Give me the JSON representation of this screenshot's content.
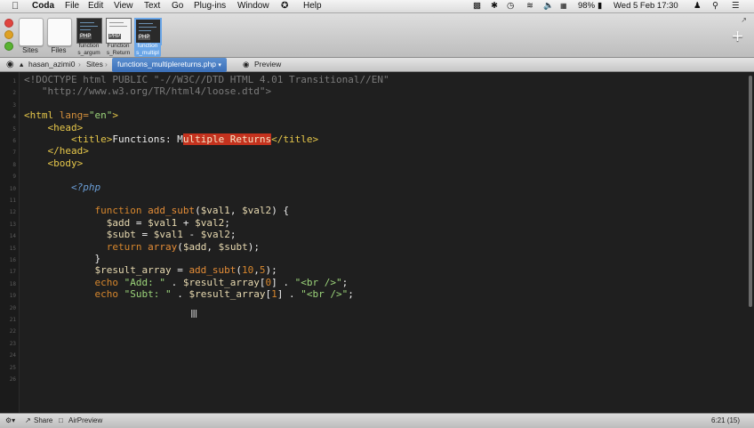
{
  "menubar": {
    "apple_icon": "apple-icon",
    "app": "Coda",
    "items": [
      "File",
      "Edit",
      "View",
      "Text",
      "Go",
      "Plug-ins",
      "Window",
      "Help"
    ],
    "battery": "98%",
    "datetime": "Wed 5 Feb  17:30",
    "flag": "UK"
  },
  "toolbar": {
    "sites_label": "Sites",
    "files_label": "Files",
    "tabs": [
      {
        "php": "PHP",
        "caption1": "function",
        "caption2": "s_argum"
      },
      {
        "php": "PHP",
        "caption1": "Function",
        "caption2": "s_Return"
      },
      {
        "php": "PHP",
        "caption1": "function",
        "caption2": "s_multipl"
      }
    ],
    "plus": "+"
  },
  "pathbar": {
    "user": "hasan_azimi0",
    "sites": "Sites",
    "file": "functions_multiplereturns.php",
    "preview": "Preview"
  },
  "editor": {
    "line_numbers": [
      "1",
      "2",
      "3",
      "4",
      "5",
      "6",
      "7",
      "8",
      "9",
      "10",
      "11",
      "12",
      "13",
      "14",
      "15",
      "16",
      "17",
      "18",
      "19",
      "20",
      "21",
      "22",
      "23",
      "24",
      "25",
      "26"
    ],
    "colors": {
      "comment": "#7b7b7b",
      "tag": "#e6c74a",
      "attr": "#d38f3c",
      "string": "#9cd47a",
      "keyword": "#d6862d",
      "function": "#e38c37",
      "variable": "#e7d9b0",
      "plain": "#eeeeee",
      "phpopen": "#6b9ed6",
      "highlight": "#c4321e"
    },
    "lines": [
      [
        [
          "c",
          "<!DOCTYPE html PUBLIC \"-//W3C//DTD HTML 4.01 Transitional//EN\""
        ]
      ],
      [
        [
          "c",
          "   \"http://www.w3.org/TR/html4/loose.dtd\">"
        ]
      ],
      [],
      [
        [
          "t",
          "<html "
        ],
        [
          "a",
          "lang="
        ],
        [
          "s",
          "\"en\""
        ],
        [
          "t",
          ">"
        ]
      ],
      [
        [
          "t",
          "    <head>"
        ]
      ],
      [
        [
          "t",
          "        <title>"
        ],
        [
          "p",
          "Functions: M"
        ],
        [
          "h",
          "ultiple Returns"
        ],
        [
          "t",
          "</title>"
        ]
      ],
      [
        [
          "t",
          "    </head>"
        ]
      ],
      [
        [
          "t",
          "    <body>"
        ]
      ],
      [],
      [
        [
          "o",
          "        <?php"
        ]
      ],
      [],
      [
        [
          "k",
          "            function "
        ],
        [
          "f",
          "add_subt"
        ],
        [
          "p",
          "("
        ],
        [
          "v",
          "$val1"
        ],
        [
          "p",
          ", "
        ],
        [
          "v",
          "$val2"
        ],
        [
          "p",
          ") {"
        ]
      ],
      [
        [
          "v",
          "              $add "
        ],
        [
          "p",
          "= "
        ],
        [
          "v",
          "$val1 "
        ],
        [
          "p",
          "+ "
        ],
        [
          "v",
          "$val2"
        ],
        [
          "p",
          ";"
        ]
      ],
      [
        [
          "v",
          "              $subt "
        ],
        [
          "p",
          "= "
        ],
        [
          "v",
          "$val1 "
        ],
        [
          "p",
          "- "
        ],
        [
          "v",
          "$val2"
        ],
        [
          "p",
          ";"
        ]
      ],
      [
        [
          "k",
          "              return "
        ],
        [
          "f",
          "array"
        ],
        [
          "p",
          "("
        ],
        [
          "v",
          "$add"
        ],
        [
          "p",
          ", "
        ],
        [
          "v",
          "$subt"
        ],
        [
          "p",
          ");"
        ]
      ],
      [
        [
          "p",
          "            }"
        ]
      ],
      [
        [
          "v",
          "            $result_array "
        ],
        [
          "p",
          "= "
        ],
        [
          "f",
          "add_subt"
        ],
        [
          "p",
          "("
        ],
        [
          "k",
          "10"
        ],
        [
          "p",
          ","
        ],
        [
          "k",
          "5"
        ],
        [
          "p",
          ");"
        ]
      ],
      [
        [
          "k",
          "            echo "
        ],
        [
          "s",
          "\"Add: \" "
        ],
        [
          "p",
          ". "
        ],
        [
          "v",
          "$result_array"
        ],
        [
          "p",
          "["
        ],
        [
          "k",
          "0"
        ],
        [
          "p",
          "] . "
        ],
        [
          "s",
          "\"<br />\""
        ],
        [
          "p",
          ";"
        ]
      ],
      [
        [
          "k",
          "            echo "
        ],
        [
          "s",
          "\"Subt: \" "
        ],
        [
          "p",
          ". "
        ],
        [
          "v",
          "$result_array"
        ],
        [
          "p",
          "["
        ],
        [
          "k",
          "1"
        ],
        [
          "p",
          "] . "
        ],
        [
          "s",
          "\"<br />\""
        ],
        [
          "p",
          ";"
        ]
      ],
      [],
      [],
      [],
      [],
      [],
      [],
      []
    ]
  },
  "statusbar": {
    "share": "Share",
    "airpreview": "AirPreview",
    "position": "6:21 (15)"
  }
}
